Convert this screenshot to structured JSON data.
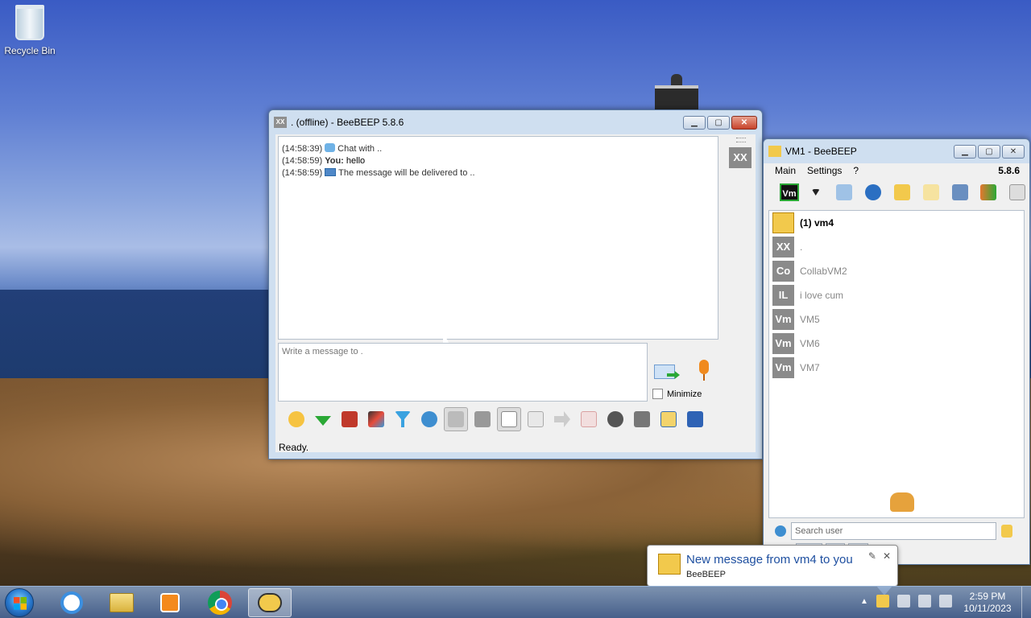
{
  "desktop": {
    "icons": [
      {
        "label": "Recycle Bin",
        "icon": "recycle-bin-icon"
      }
    ]
  },
  "chat_window": {
    "title": ". (offline) - BeeBEEP 5.8.6",
    "title_icon_text": "XX",
    "side_avatar": "XX",
    "messages": [
      {
        "time": "(14:58:39)",
        "icon": "chat-bubble-icon",
        "text": "Chat with .."
      },
      {
        "time": "(14:58:59)",
        "sender": "You:",
        "text": "hello"
      },
      {
        "time": "(14:58:59)",
        "icon": "envelope-icon",
        "text": "The message will be delivered to .."
      }
    ],
    "input_placeholder": "Write a message to .",
    "minimize_label": "Minimize",
    "status": "Ready.",
    "toolbar_icons": [
      "emoticon-icon",
      "dropdown-arrow-icon",
      "font-icon",
      "color-icon",
      "filter-icon",
      "settings-gears-icon",
      "spellcheck-icon",
      "font-size-icon",
      "note-icon",
      "file-icon",
      "forward-icon",
      "html-icon",
      "record-icon",
      "calendar-icon",
      "edit-icon",
      "save-icon"
    ]
  },
  "main_window": {
    "title": "VM1 - BeeBEEP",
    "menu": [
      "Main",
      "Settings",
      "?"
    ],
    "version": "5.8.6",
    "status_badge": "Vm",
    "users": [
      {
        "avatar": "envelope",
        "name": "(1) vm4",
        "bold": true
      },
      {
        "avatar": "XX",
        "name": "."
      },
      {
        "avatar": "Co",
        "name": "CollabVM2"
      },
      {
        "avatar": "IL",
        "name": "i love cum"
      },
      {
        "avatar": "Vm",
        "name": "VM5"
      },
      {
        "avatar": "Vm",
        "name": "VM6"
      },
      {
        "avatar": "Vm",
        "name": "VM7"
      }
    ],
    "search_placeholder": "Search user",
    "tab_count": "1"
  },
  "notification": {
    "title": "New message from vm4 to you",
    "subtitle": "BeeBEEP"
  },
  "taskbar": {
    "apps": [
      "internet-explorer-icon",
      "file-explorer-icon",
      "media-player-icon",
      "chrome-icon",
      "beebeep-icon"
    ],
    "time": "2:59 PM",
    "date": "10/11/2023"
  }
}
